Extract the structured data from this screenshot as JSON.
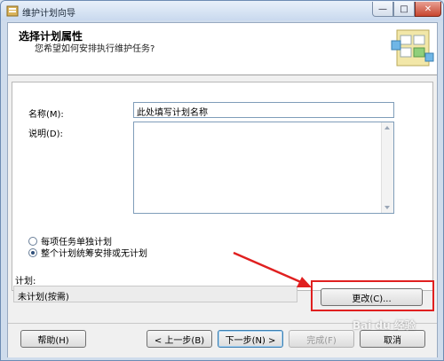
{
  "window": {
    "title": "维护计划向导"
  },
  "caption_buttons": {
    "minimize": "—",
    "maximize": "□",
    "close": "✕"
  },
  "header": {
    "title": "选择计划属性",
    "subtitle": "您希望如何安排执行维护任务?"
  },
  "form": {
    "name_label": "名称(M):",
    "name_value": "此处填写计划名称",
    "description_label": "说明(D):",
    "description_value": ""
  },
  "schedule_options": [
    {
      "label": "每项任务单独计划",
      "checked": false
    },
    {
      "label": "整个计划统筹安排或无计划",
      "checked": true
    }
  ],
  "plan": {
    "label": "计划:",
    "value": "未计划(按需)",
    "change_button": "更改(C)..."
  },
  "footer": {
    "help": "帮助(H)",
    "back": "< 上一步(B)",
    "next": "下一步(N) >",
    "finish": "完成(F)",
    "cancel": "取消"
  },
  "watermark": "Bai du 经验",
  "colors": {
    "annotation": "#e02020",
    "window_frame": "#6d8bb3"
  }
}
